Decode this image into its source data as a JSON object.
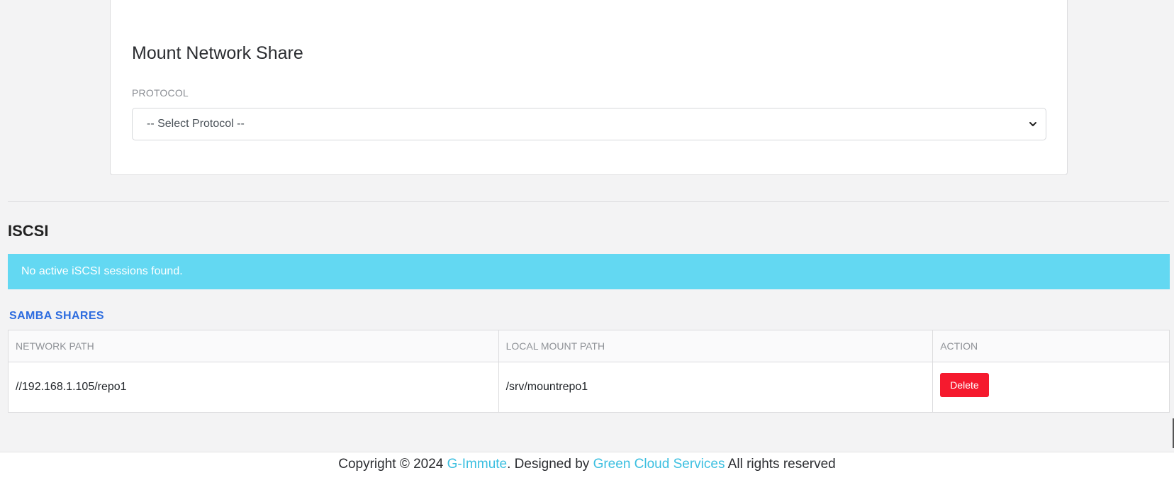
{
  "mount": {
    "title": "Mount Network Share",
    "protocol_label": "PROTOCOL",
    "protocol_selected": "-- Select Protocol --"
  },
  "iscsi": {
    "heading": "ISCSI",
    "alert": "No active iSCSI sessions found."
  },
  "samba": {
    "heading": "SAMBA SHARES",
    "columns": [
      "NETWORK PATH",
      "LOCAL MOUNT PATH",
      "ACTION"
    ],
    "rows": [
      {
        "network_path": "//192.168.1.105/repo1",
        "local_path": "/srv/mountrepo1",
        "action": "Delete"
      }
    ]
  },
  "footer": {
    "prefix": "Copyright © 2024 ",
    "company": "G-Immute",
    "middle": ". Designed by ",
    "designer": "Green Cloud Services",
    "suffix": " All rights reserved"
  },
  "colors": {
    "alert_bg": "#63d8f2",
    "heading_accent": "#2d6cdf",
    "danger": "#f51a2e",
    "link": "#3bbfe0"
  }
}
